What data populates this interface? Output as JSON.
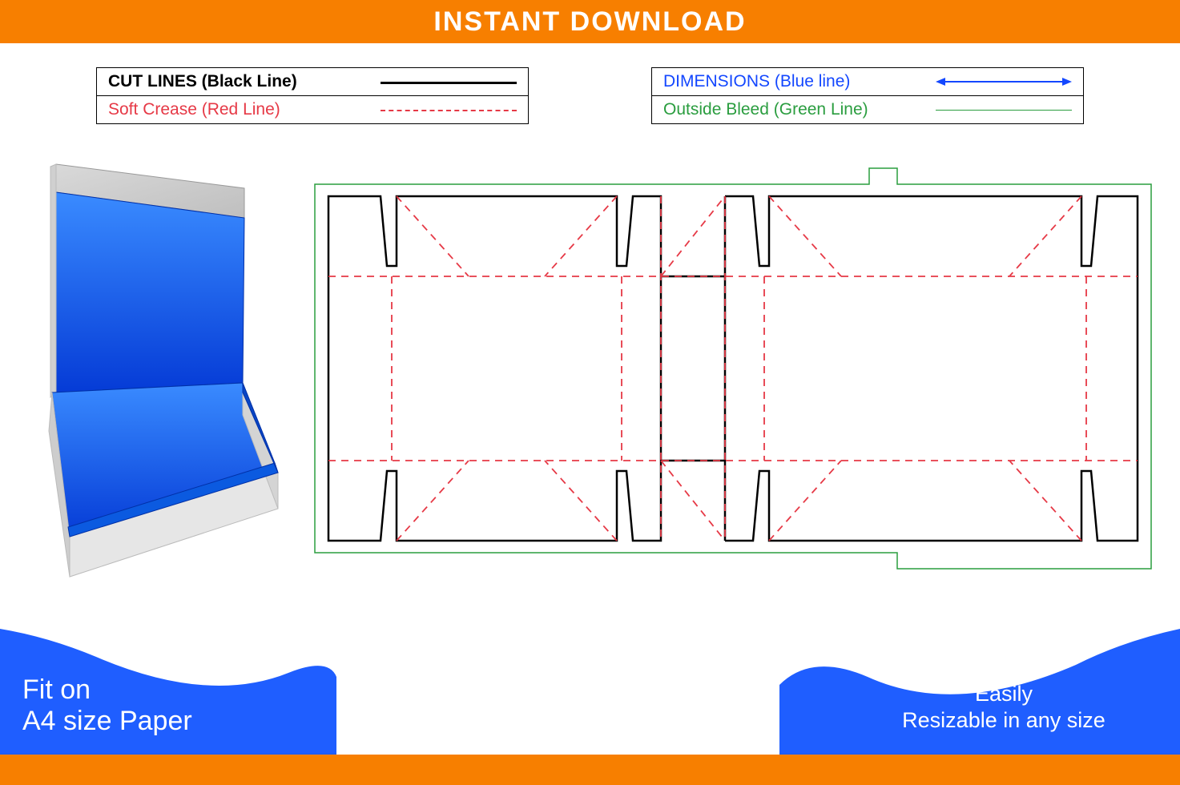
{
  "header": {
    "title": "INSTANT DOWNLOAD"
  },
  "legend": {
    "left": {
      "row1": "CUT LINES (Black Line)",
      "row2": "Soft Crease (Red Line)"
    },
    "right": {
      "row1": "DIMENSIONS (Blue line)",
      "row2": "Outside Bleed (Green Line)"
    }
  },
  "footer": {
    "left_line1": "Fit on",
    "left_line2": "A4 size Paper",
    "right_line1": "Easily",
    "right_line2": "Resizable in any size"
  },
  "colors": {
    "orange": "#f77f00",
    "blue": "#1347ff",
    "box_blue": "#0b5ae0",
    "red": "#e63946",
    "green": "#2a9d3f"
  }
}
